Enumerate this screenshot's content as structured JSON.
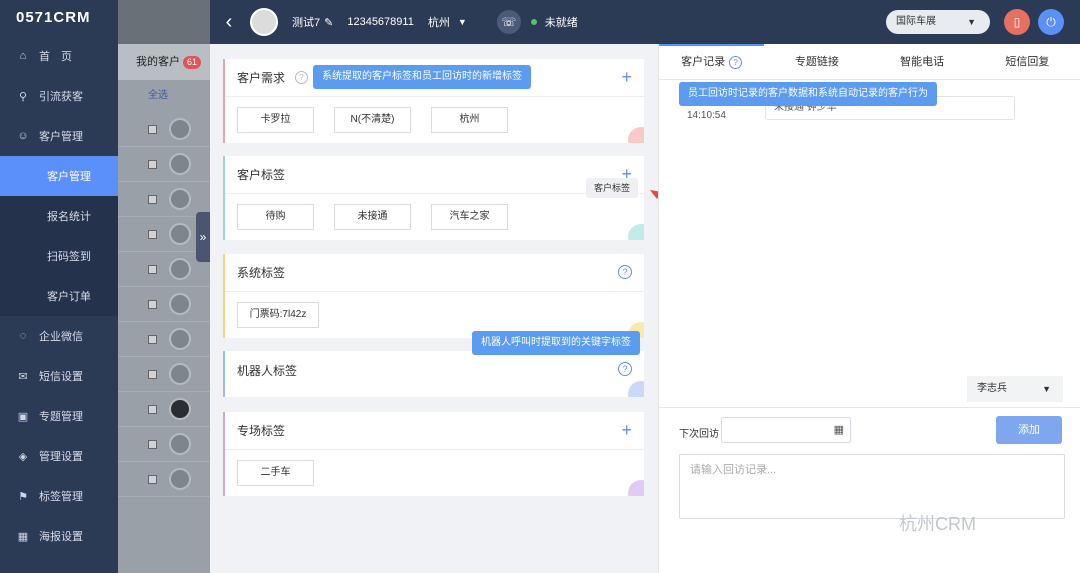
{
  "sidebar": {
    "logo": "0571CRM",
    "items": [
      {
        "label": "首　页",
        "icon": "home-icon",
        "glyph": "⌂"
      },
      {
        "label": "引流获客",
        "icon": "funnel-icon",
        "glyph": "⚲"
      },
      {
        "label": "客户管理",
        "icon": "user-icon",
        "glyph": "☺"
      },
      {
        "label": "客户管理",
        "icon": "",
        "glyph": ""
      },
      {
        "label": "报名统计",
        "icon": "",
        "glyph": ""
      },
      {
        "label": "扫码签到",
        "icon": "",
        "glyph": ""
      },
      {
        "label": "客户订单",
        "icon": "",
        "glyph": ""
      },
      {
        "label": "企业微信",
        "icon": "wechat-icon",
        "glyph": "◌"
      },
      {
        "label": "短信设置",
        "icon": "mail-icon",
        "glyph": "✉"
      },
      {
        "label": "专题管理",
        "icon": "topic-icon",
        "glyph": "▣"
      },
      {
        "label": "管理设置",
        "icon": "layers-icon",
        "glyph": "◈"
      },
      {
        "label": "标签管理",
        "icon": "bookmark-icon",
        "glyph": "⚑"
      },
      {
        "label": "海报设置",
        "icon": "image-icon",
        "glyph": "▦"
      }
    ]
  },
  "customer_list": {
    "title": "我的客户",
    "count": "61",
    "select_all": "全选"
  },
  "topbar": {
    "name": "测试7",
    "phone": "12345678911",
    "city": "杭州",
    "status": "未就绪",
    "project": "国际车展",
    "colors": {
      "bg": "#2b3a55",
      "status_dot": "#4fc26b"
    }
  },
  "tag_panel": {
    "requirement": {
      "title": "客户需求",
      "tip": "系统提取的客户标签和员工回访时的新增标签",
      "tags": [
        "卡罗拉",
        "N(不清楚)",
        "杭州"
      ]
    },
    "customer_tags": {
      "title": "客户标签",
      "hover_tip": "客户标签",
      "tags": [
        "待购",
        "未接通",
        "汽车之家"
      ]
    },
    "system_tags": {
      "title": "系统标签",
      "tags": [
        "门票码:7l42z"
      ]
    },
    "robot_tags": {
      "title": "机器人标签",
      "tip": "机器人呼叫时提取到的关键字标签"
    },
    "special_tags": {
      "title": "专场标签",
      "tags": [
        "二手车"
      ]
    }
  },
  "right_panel": {
    "tabs": [
      "客户记录",
      "专题链接",
      "智能电话",
      "短信回复"
    ],
    "record_tip": "员工回访时记录的客户数据和系统自动记录的客户行为",
    "record": {
      "time": "14:10:54",
      "text": "未接通  钟少华"
    },
    "agent": "李志兵",
    "next_visit_label": "下次回访",
    "add_button": "添加",
    "record_placeholder": "请输入回访记录...",
    "watermark": "杭州CRM"
  }
}
